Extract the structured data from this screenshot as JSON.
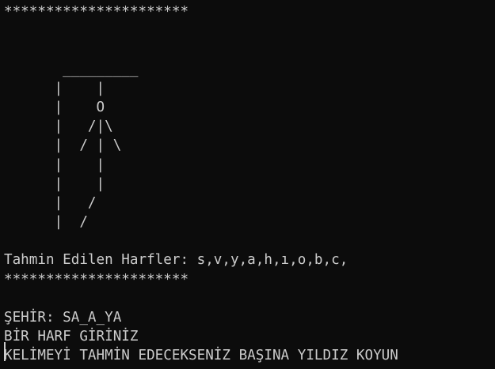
{
  "theme": {
    "background": "#0c0c0c",
    "foreground": "#cccccc"
  },
  "console": {
    "lines": [
      "**********************",
      "",
      "",
      "       _________",
      "      |    |",
      "      |    O",
      "      |   /|\\",
      "      |  / | \\",
      "      |    |",
      "      |    |",
      "      |   /",
      "      |  /",
      "",
      "Tahmin Edilen Harfler: s,v,y,a,h,ı,o,b,c,",
      "**********************",
      "",
      "ŞEHİR: SA_A_YA",
      "BİR HARF GİRİNİZ",
      "KELİMEYİ TAHMİN EDECEKSENİZ BAŞINA YILDIZ KOYUN"
    ]
  }
}
